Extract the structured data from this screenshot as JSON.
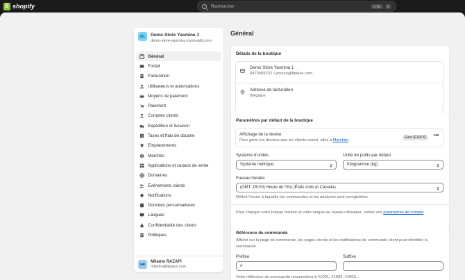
{
  "topbar": {
    "brand": "shopify",
    "search_placeholder": "Rechercher",
    "shortcut_keys": [
      "CTRL",
      "K"
    ]
  },
  "colors": {
    "brand_green": "#95bf47",
    "link": "#005bd3",
    "avatar_store": "#78d1f7"
  },
  "sidebar": {
    "store_initials": "D1",
    "store_name": "Demo Store Yasmina 1",
    "store_url": "demo-store-yasmina.myshopify.com",
    "items": [
      {
        "label": "Général",
        "icon": "store-icon",
        "active": true
      },
      {
        "label": "Forfait",
        "icon": "plan-icon"
      },
      {
        "label": "Facturation",
        "icon": "billing-icon"
      },
      {
        "label": "Utilisateurs et autorisations",
        "icon": "users-icon"
      },
      {
        "label": "Moyens de paiement",
        "icon": "payment-methods-icon"
      },
      {
        "label": "Paiement",
        "icon": "cart-icon"
      },
      {
        "label": "Comptes clients",
        "icon": "customer-icon"
      },
      {
        "label": "Expédition et livraison",
        "icon": "truck-icon"
      },
      {
        "label": "Taxes et frais de douane",
        "icon": "tax-icon"
      },
      {
        "label": "Emplacements",
        "icon": "location-icon"
      },
      {
        "label": "Marchés",
        "icon": "globe-icon"
      },
      {
        "label": "Applications et canaux de vente",
        "icon": "apps-icon"
      },
      {
        "label": "Domaines",
        "icon": "domain-icon"
      },
      {
        "label": "Événements clients",
        "icon": "events-icon"
      },
      {
        "label": "Notifications",
        "icon": "bell-icon"
      },
      {
        "label": "Données personnalisées",
        "icon": "data-icon"
      },
      {
        "label": "Langues",
        "icon": "language-icon"
      },
      {
        "label": "Confidentialité des clients",
        "icon": "lock-icon"
      },
      {
        "label": "Politiques",
        "icon": "policy-icon"
      }
    ],
    "user_initials": "MR",
    "user_name": "Milanto RAZAFI",
    "user_email": "milanto@ltplace.com"
  },
  "main": {
    "title": "Général",
    "store_details": {
      "title": "Détails de la boutique",
      "store_name": "Demo Store Yasmina 1",
      "store_contact": "0473565232 • ynoury@ltplace.com",
      "billing_label": "Adresse de facturation",
      "billing_country": "Belgique"
    },
    "defaults": {
      "title": "Paramètres par défaut de la boutique",
      "currency_title": "Affichage de la devise",
      "currency_desc": "Pour gérer les devises que les clients voient, allez à",
      "currency_link": "Marchés",
      "currency_badge": "Euro (EUR €)",
      "unit_system_label": "Système d'unités",
      "unit_system_value": "Système métrique",
      "weight_unit_label": "Unité de poids par défaut",
      "weight_unit_value": "Kilogramme (kg)",
      "timezone_label": "Fuseau horaire",
      "timezone_value": "(GMT -05:00) Heure de l'Est (États-Unis et Canada)",
      "timezone_help": "Définit l'heure à laquelle les commandes et les analyses sont enregistrées",
      "account_note": "Pour changer votre fuseau horaire et votre langue au niveau utilisateur, visitez vos",
      "account_link": "paramètres de compte"
    },
    "order_ref": {
      "title": "Référence de commande",
      "desc": "Affiché sur la page de commande, les pages clients et les notifications de commande client pour identifier la commande",
      "prefix_label": "Préfixe",
      "prefix_value": "#",
      "suffix_label": "Suffixe",
      "suffix_value": "",
      "preview": "Votre référence de commande ressemblera à #1001, #1002, #1003..."
    }
  }
}
